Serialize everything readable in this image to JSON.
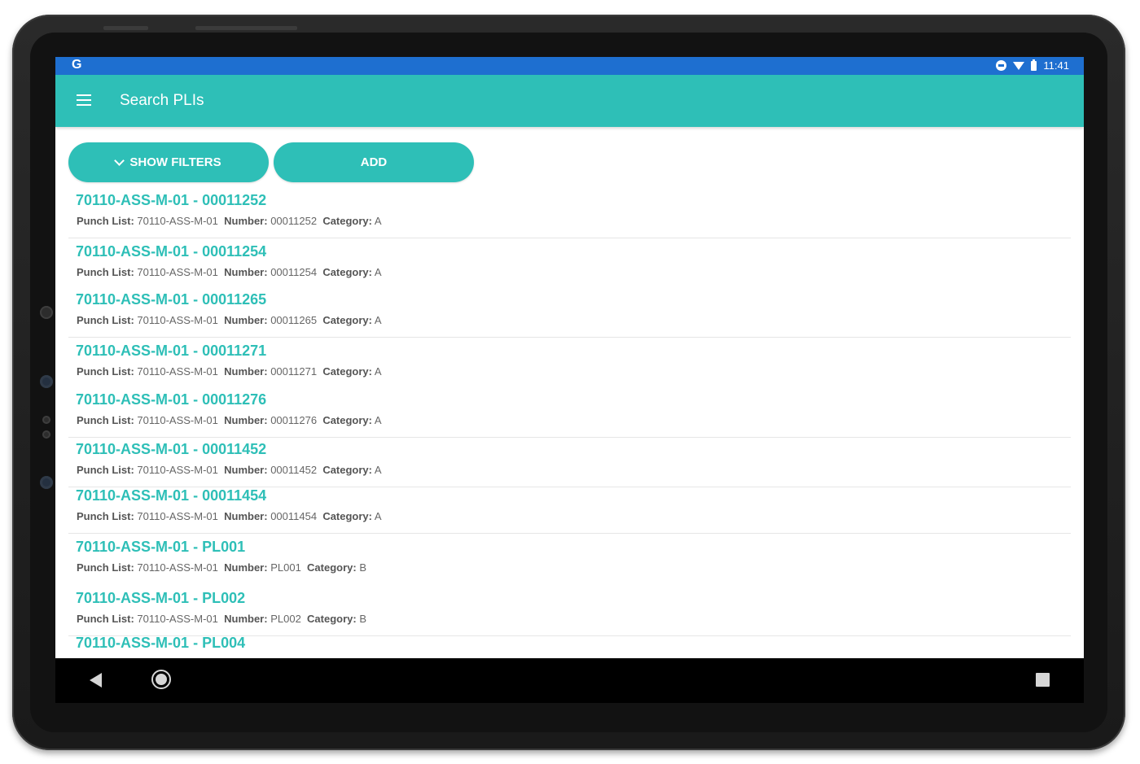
{
  "status_bar": {
    "app_glyph": "G",
    "time": "11:41",
    "icons": [
      "do-not-disturb-icon",
      "wifi-icon",
      "battery-icon"
    ]
  },
  "app_bar": {
    "title": "Search PLIs",
    "menu_icon": "hamburger-menu-icon"
  },
  "actions": {
    "show_filters_label": "SHOW FILTERS",
    "add_label": "ADD"
  },
  "labels": {
    "punch_list": "Punch List:",
    "number": "Number:",
    "category": "Category:"
  },
  "items": [
    {
      "title": "70110-ASS-M-01 - 00011252",
      "punch_list": "70110-ASS-M-01",
      "number": "00011252",
      "category": "A"
    },
    {
      "title": "70110-ASS-M-01 - 00011254",
      "punch_list": "70110-ASS-M-01",
      "number": "00011254",
      "category": "A"
    },
    {
      "title": "70110-ASS-M-01 - 00011265",
      "punch_list": "70110-ASS-M-01",
      "number": "00011265",
      "category": "A"
    },
    {
      "title": "70110-ASS-M-01 - 00011271",
      "punch_list": "70110-ASS-M-01",
      "number": "00011271",
      "category": "A"
    },
    {
      "title": "70110-ASS-M-01 - 00011276",
      "punch_list": "70110-ASS-M-01",
      "number": "00011276",
      "category": "A"
    },
    {
      "title": "70110-ASS-M-01 - 00011452",
      "punch_list": "70110-ASS-M-01",
      "number": "00011452",
      "category": "A"
    },
    {
      "title": "70110-ASS-M-01 - 00011454",
      "punch_list": "70110-ASS-M-01",
      "number": "00011454",
      "category": "A"
    },
    {
      "title": "70110-ASS-M-01 - PL001",
      "punch_list": "70110-ASS-M-01",
      "number": "PL001",
      "category": "B"
    },
    {
      "title": "70110-ASS-M-01 - PL002",
      "punch_list": "70110-ASS-M-01",
      "number": "PL002",
      "category": "B"
    },
    {
      "title": "70110-ASS-M-01 - PL004"
    }
  ],
  "nav_bar": {
    "icons": [
      "back-icon",
      "home-icon",
      "recent-apps-icon"
    ]
  },
  "colors": {
    "accent": "#2ebfb7",
    "status_bar": "#1e6fd0",
    "nav_bar": "#000000"
  }
}
